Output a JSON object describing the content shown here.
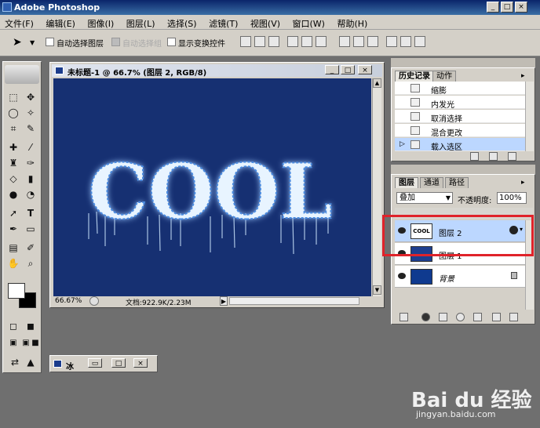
{
  "window": {
    "title": "Adobe Photoshop"
  },
  "menu": [
    "文件(F)",
    "编辑(E)",
    "图像(I)",
    "图层(L)",
    "选择(S)",
    "滤镜(T)",
    "视图(V)",
    "窗口(W)",
    "帮助(H)"
  ],
  "options": {
    "auto_select_layer": "自动选择图层",
    "auto_select_group": "自动选择组",
    "show_transform": "显示变换控件"
  },
  "document": {
    "title": "未标题-1 @ 66.7% (图层 2, RGB/8)",
    "canvas_text": "COOL",
    "zoom": "66.67%",
    "doc_info": "文档:922.9K/2.23M"
  },
  "history": {
    "tabs": [
      "历史记录",
      "动作"
    ],
    "items": [
      "缩膨",
      "内发光",
      "取消选择",
      "混合更改",
      "载入选区"
    ]
  },
  "layers": {
    "tabs": [
      "图层",
      "通道",
      "路径"
    ],
    "blend_mode": "叠加",
    "opacity_label": "不透明度:",
    "opacity_value": "100%",
    "items": [
      {
        "name": "图层 2",
        "thumb_text": "COOL",
        "selected": true
      },
      {
        "name": "图层 1",
        "selected": false
      },
      {
        "name": "背景",
        "selected": false
      }
    ]
  },
  "minimized": {
    "title": "冰"
  },
  "watermark": {
    "logo": "Bai du 经验",
    "url": "jingyan.baidu.com"
  },
  "colors": {
    "canvas_bg": "#163072",
    "highlight": "#e0232a",
    "selected_row": "#bcd7ff"
  }
}
